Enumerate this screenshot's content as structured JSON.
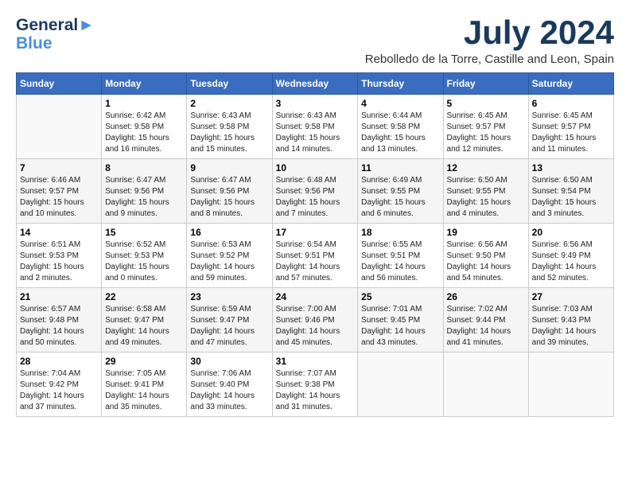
{
  "logo": {
    "line1": "General",
    "line2": "Blue"
  },
  "title": "July 2024",
  "location": "Rebolledo de la Torre, Castille and Leon, Spain",
  "weekdays": [
    "Sunday",
    "Monday",
    "Tuesday",
    "Wednesday",
    "Thursday",
    "Friday",
    "Saturday"
  ],
  "weeks": [
    [
      {
        "num": "",
        "info": ""
      },
      {
        "num": "1",
        "info": "Sunrise: 6:42 AM\nSunset: 9:58 PM\nDaylight: 15 hours\nand 16 minutes."
      },
      {
        "num": "2",
        "info": "Sunrise: 6:43 AM\nSunset: 9:58 PM\nDaylight: 15 hours\nand 15 minutes."
      },
      {
        "num": "3",
        "info": "Sunrise: 6:43 AM\nSunset: 9:58 PM\nDaylight: 15 hours\nand 14 minutes."
      },
      {
        "num": "4",
        "info": "Sunrise: 6:44 AM\nSunset: 9:58 PM\nDaylight: 15 hours\nand 13 minutes."
      },
      {
        "num": "5",
        "info": "Sunrise: 6:45 AM\nSunset: 9:57 PM\nDaylight: 15 hours\nand 12 minutes."
      },
      {
        "num": "6",
        "info": "Sunrise: 6:45 AM\nSunset: 9:57 PM\nDaylight: 15 hours\nand 11 minutes."
      }
    ],
    [
      {
        "num": "7",
        "info": "Sunrise: 6:46 AM\nSunset: 9:57 PM\nDaylight: 15 hours\nand 10 minutes."
      },
      {
        "num": "8",
        "info": "Sunrise: 6:47 AM\nSunset: 9:56 PM\nDaylight: 15 hours\nand 9 minutes."
      },
      {
        "num": "9",
        "info": "Sunrise: 6:47 AM\nSunset: 9:56 PM\nDaylight: 15 hours\nand 8 minutes."
      },
      {
        "num": "10",
        "info": "Sunrise: 6:48 AM\nSunset: 9:56 PM\nDaylight: 15 hours\nand 7 minutes."
      },
      {
        "num": "11",
        "info": "Sunrise: 6:49 AM\nSunset: 9:55 PM\nDaylight: 15 hours\nand 6 minutes."
      },
      {
        "num": "12",
        "info": "Sunrise: 6:50 AM\nSunset: 9:55 PM\nDaylight: 15 hours\nand 4 minutes."
      },
      {
        "num": "13",
        "info": "Sunrise: 6:50 AM\nSunset: 9:54 PM\nDaylight: 15 hours\nand 3 minutes."
      }
    ],
    [
      {
        "num": "14",
        "info": "Sunrise: 6:51 AM\nSunset: 9:53 PM\nDaylight: 15 hours\nand 2 minutes."
      },
      {
        "num": "15",
        "info": "Sunrise: 6:52 AM\nSunset: 9:53 PM\nDaylight: 15 hours\nand 0 minutes."
      },
      {
        "num": "16",
        "info": "Sunrise: 6:53 AM\nSunset: 9:52 PM\nDaylight: 14 hours\nand 59 minutes."
      },
      {
        "num": "17",
        "info": "Sunrise: 6:54 AM\nSunset: 9:51 PM\nDaylight: 14 hours\nand 57 minutes."
      },
      {
        "num": "18",
        "info": "Sunrise: 6:55 AM\nSunset: 9:51 PM\nDaylight: 14 hours\nand 56 minutes."
      },
      {
        "num": "19",
        "info": "Sunrise: 6:56 AM\nSunset: 9:50 PM\nDaylight: 14 hours\nand 54 minutes."
      },
      {
        "num": "20",
        "info": "Sunrise: 6:56 AM\nSunset: 9:49 PM\nDaylight: 14 hours\nand 52 minutes."
      }
    ],
    [
      {
        "num": "21",
        "info": "Sunrise: 6:57 AM\nSunset: 9:48 PM\nDaylight: 14 hours\nand 50 minutes."
      },
      {
        "num": "22",
        "info": "Sunrise: 6:58 AM\nSunset: 9:47 PM\nDaylight: 14 hours\nand 49 minutes."
      },
      {
        "num": "23",
        "info": "Sunrise: 6:59 AM\nSunset: 9:47 PM\nDaylight: 14 hours\nand 47 minutes."
      },
      {
        "num": "24",
        "info": "Sunrise: 7:00 AM\nSunset: 9:46 PM\nDaylight: 14 hours\nand 45 minutes."
      },
      {
        "num": "25",
        "info": "Sunrise: 7:01 AM\nSunset: 9:45 PM\nDaylight: 14 hours\nand 43 minutes."
      },
      {
        "num": "26",
        "info": "Sunrise: 7:02 AM\nSunset: 9:44 PM\nDaylight: 14 hours\nand 41 minutes."
      },
      {
        "num": "27",
        "info": "Sunrise: 7:03 AM\nSunset: 9:43 PM\nDaylight: 14 hours\nand 39 minutes."
      }
    ],
    [
      {
        "num": "28",
        "info": "Sunrise: 7:04 AM\nSunset: 9:42 PM\nDaylight: 14 hours\nand 37 minutes."
      },
      {
        "num": "29",
        "info": "Sunrise: 7:05 AM\nSunset: 9:41 PM\nDaylight: 14 hours\nand 35 minutes."
      },
      {
        "num": "30",
        "info": "Sunrise: 7:06 AM\nSunset: 9:40 PM\nDaylight: 14 hours\nand 33 minutes."
      },
      {
        "num": "31",
        "info": "Sunrise: 7:07 AM\nSunset: 9:38 PM\nDaylight: 14 hours\nand 31 minutes."
      },
      {
        "num": "",
        "info": ""
      },
      {
        "num": "",
        "info": ""
      },
      {
        "num": "",
        "info": ""
      }
    ]
  ]
}
